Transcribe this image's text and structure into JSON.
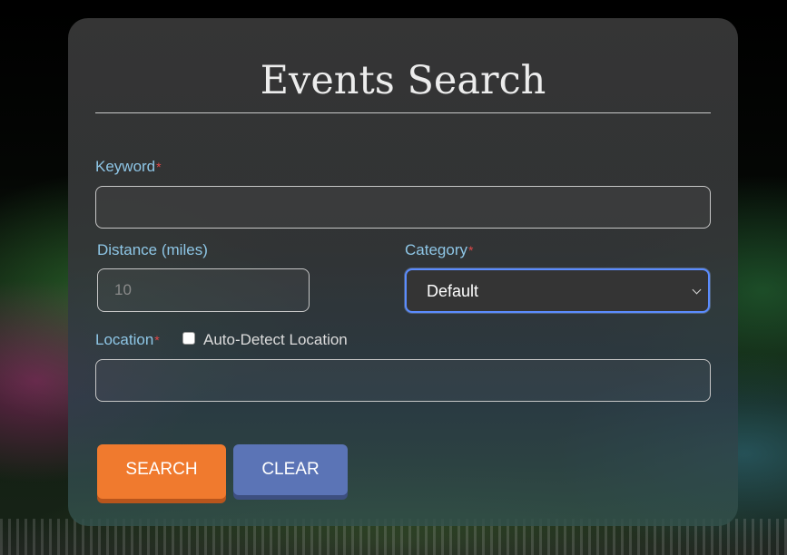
{
  "form": {
    "title": "Events Search",
    "keyword": {
      "label": "Keyword",
      "required_mark": "*",
      "value": ""
    },
    "distance": {
      "label": "Distance (miles)",
      "placeholder": "10",
      "value": ""
    },
    "category": {
      "label": "Category",
      "required_mark": "*",
      "selected": "Default"
    },
    "location": {
      "label": "Location",
      "required_mark": "*",
      "value": "",
      "auto_detect": {
        "label": "Auto-Detect Location",
        "checked": false
      }
    },
    "buttons": {
      "search": "SEARCH",
      "clear": "CLEAR"
    }
  },
  "colors": {
    "label": "#8ec6e6",
    "required": "#e04848",
    "search_button": "#f07a2e",
    "clear_button": "#5b74b6",
    "focus_ring": "#5b8cff"
  },
  "icons": {
    "select_arrow": "chevron-down-icon"
  }
}
